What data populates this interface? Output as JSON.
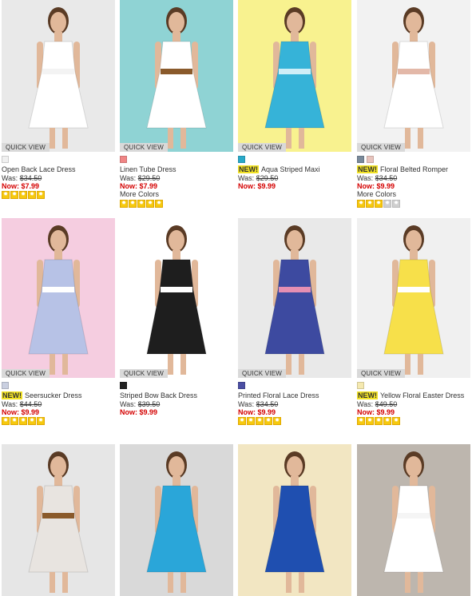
{
  "quick_view_label": "QUICK VIEW",
  "was_label": "Was:",
  "now_label": "Now:",
  "more_colors_label": "More Colors",
  "new_label": "NEW!",
  "products": [
    {
      "name": "Open Back Lace Dress",
      "was": "$34.50",
      "now": "$7.99",
      "is_new": false,
      "more_colors": false,
      "swatches": [
        "#f0f0f0"
      ],
      "stars": 5,
      "star_total": 5,
      "bg": "#e9e9e9",
      "dress": "#ffffff",
      "accent": "#f3f3f3"
    },
    {
      "name": "Linen Tube Dress",
      "was": "$29.50",
      "now": "$7.99",
      "is_new": false,
      "more_colors": true,
      "swatches": [
        "#f08585"
      ],
      "stars": 5,
      "star_total": 5,
      "bg": "#8fd3d4",
      "dress": "#ffffff",
      "accent": "#8a5a2b"
    },
    {
      "name": "Aqua Striped Maxi",
      "was": "$29.50",
      "now": "$9.99",
      "is_new": true,
      "more_colors": false,
      "swatches": [
        "#29a9c9"
      ],
      "stars": 0,
      "star_total": 0,
      "bg": "#f8f28f",
      "dress": "#36b3d8",
      "accent": "#cfeef7"
    },
    {
      "name": "Floral Belted Romper",
      "was": "$34.50",
      "now": "$9.99",
      "is_new": true,
      "more_colors": true,
      "swatches": [
        "#7a8a9a",
        "#e8c4bd"
      ],
      "stars": 3,
      "star_total": 5,
      "bg": "#f2f2f2",
      "dress": "#ffffff",
      "accent": "#e3b8a8"
    },
    {
      "name": "Seersucker Dress",
      "was": "$44.50",
      "now": "$9.99",
      "is_new": true,
      "more_colors": false,
      "swatches": [
        "#c9cfe0"
      ],
      "stars": 5,
      "star_total": 5,
      "bg": "#f5cde0",
      "dress": "#b7c2e6",
      "accent": "#ffffff"
    },
    {
      "name": "Striped Bow Back Dress",
      "was": "$39.50",
      "now": "$9.99",
      "is_new": false,
      "more_colors": false,
      "swatches": [
        "#222222"
      ],
      "stars": 0,
      "star_total": 0,
      "bg": "#ffffff",
      "dress": "#1e1e1e",
      "accent": "#ffffff"
    },
    {
      "name": "Printed Floral Lace Dress",
      "was": "$34.50",
      "now": "$9.99",
      "is_new": false,
      "more_colors": false,
      "swatches": [
        "#4b4fa3"
      ],
      "stars": 5,
      "star_total": 5,
      "bg": "#e9e9e9",
      "dress": "#3d4aa0",
      "accent": "#e58fb3"
    },
    {
      "name": "Yellow Floral Easter Dress",
      "was": "$49.50",
      "now": "$9.99",
      "is_new": true,
      "more_colors": false,
      "swatches": [
        "#f5e9b0"
      ],
      "stars": 5,
      "star_total": 5,
      "bg": "#f0f0f0",
      "dress": "#f7e04a",
      "accent": "#ffffff"
    },
    {
      "bg": "#e6e6e6",
      "dress": "#e8e4e0",
      "accent": "#8a5a2b"
    },
    {
      "bg": "#d9d9d9",
      "dress": "#2aa6d9",
      "accent": "#2aa6d9"
    },
    {
      "bg": "#f2e6c2",
      "dress": "#1f4fb0",
      "accent": "#1f4fb0"
    },
    {
      "bg": "#bdb6ae",
      "dress": "#ffffff",
      "accent": "#f5f5f5"
    }
  ]
}
